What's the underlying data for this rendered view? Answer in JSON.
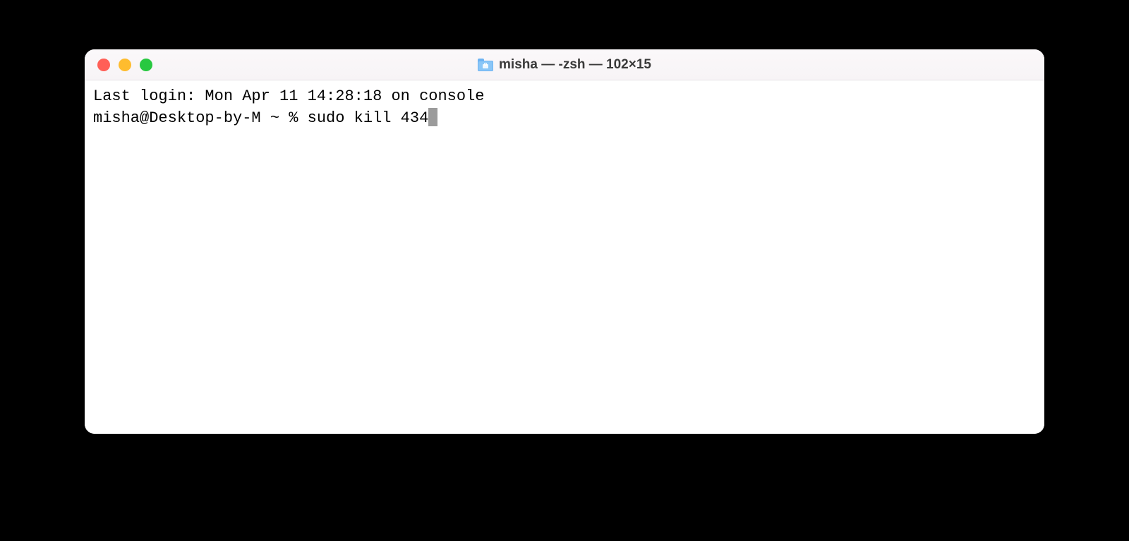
{
  "window": {
    "title": "misha — -zsh — 102×15"
  },
  "terminal": {
    "last_login_line": "Last login: Mon Apr 11 14:28:18 on console",
    "prompt": "misha@Desktop-by-M ~ % ",
    "command": "sudo kill 434"
  }
}
